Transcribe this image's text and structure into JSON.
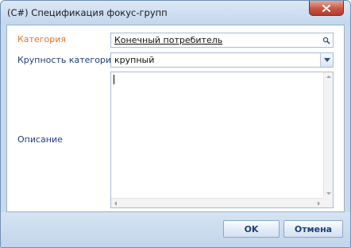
{
  "window": {
    "title": "(C#) Спецификация фокус-групп",
    "close_icon": "close-icon",
    "accent_color": "#c65544"
  },
  "form": {
    "category_label": "Категория",
    "category_value": "Конечный потребитель",
    "category_button_icon": "search-icon",
    "size_label": "Крупность категории",
    "size_value": "крупный",
    "size_button_icon": "chevron-down-icon",
    "description_label": "Описание",
    "description_value": ""
  },
  "buttons": {
    "ok_label": "OK",
    "cancel_label": "Отмена"
  }
}
